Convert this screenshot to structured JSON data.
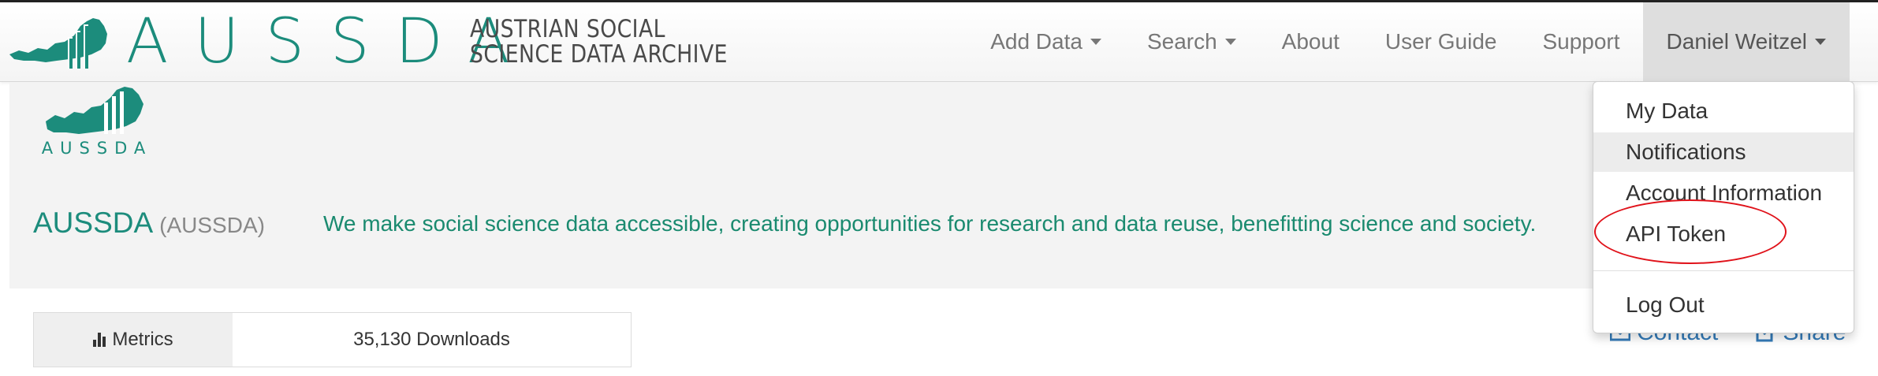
{
  "brand": {
    "name": "AUSSDA",
    "subtitle_line1": "AUSTRIAN SOCIAL",
    "subtitle_line2": "SCIENCE DATA ARCHIVE",
    "accent_color": "#1c8c7c",
    "logo_icon": "austria-map-bars-icon"
  },
  "nav": {
    "items": [
      {
        "label": "Add Data",
        "has_caret": true
      },
      {
        "label": "Search",
        "has_caret": true
      },
      {
        "label": "About",
        "has_caret": false
      },
      {
        "label": "User Guide",
        "has_caret": false
      },
      {
        "label": "Support",
        "has_caret": false
      }
    ],
    "user": {
      "label": "Daniel Weitzel",
      "has_caret": true
    }
  },
  "user_menu": {
    "items": [
      {
        "label": "My Data"
      },
      {
        "label": "Notifications"
      },
      {
        "label": "Account Information"
      },
      {
        "label": "API Token"
      }
    ],
    "logout": "Log Out",
    "highlighted_item": "Notifications",
    "annotated_item": "API Token",
    "annotation_color": "#e0121a"
  },
  "dataverse": {
    "logo_text": "AUSSDA",
    "title": "AUSSDA",
    "alias": "(AUSSDA)",
    "tagline": "We make social science data accessible, creating opportunities for research and data reuse, benefitting science and society."
  },
  "metrics": {
    "label": "Metrics",
    "icon": "bar-chart-icon",
    "downloads": "35,130 Downloads"
  },
  "actions": {
    "contact": "Contact",
    "share": "Share",
    "link_color": "#337ab7"
  }
}
